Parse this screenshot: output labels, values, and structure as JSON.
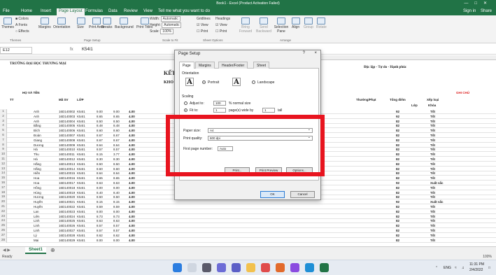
{
  "window": {
    "title": "Book1 - Excel (Product Activation Failed)"
  },
  "tabs": [
    "File",
    "Home",
    "Insert",
    "Page Layout",
    "Formulas",
    "Data",
    "Review",
    "View"
  ],
  "tabs_active": "Page Layout",
  "tell_me": "Tell me what you want to do",
  "account": {
    "signin": "Sign in",
    "share": "Share"
  },
  "ribbon": {
    "themes": "Themes",
    "colors": "Colors",
    "fonts": "Fonts",
    "effects": "Effects",
    "margins": "Margins",
    "orientation": "Orientation",
    "size": "Size",
    "print_area": "Print Area",
    "breaks": "Breaks",
    "background": "Background",
    "print_titles": "Print Titles",
    "width_label": "Width:",
    "width_value": "Automatic",
    "height_label": "Height:",
    "height_value": "Automatic",
    "scale_label": "Scale:",
    "scale_value": "100%",
    "gridlines": "Gridlines",
    "headings": "Headings",
    "view1": "View",
    "view2": "View",
    "print1": "Print",
    "print2": "Print",
    "bring_forward": "Bring Forward",
    "send_backward": "Send Backward",
    "selection_pane": "Selection Pane",
    "align": "Align",
    "group": "Group",
    "rotate": "Rotate",
    "grp_themes": "Themes",
    "grp_page_setup": "Page Setup",
    "grp_scale": "Scale to Fit",
    "grp_sheet_options": "Sheet Options",
    "grp_arrange": "Arrange"
  },
  "formula_bar": {
    "name_box": "E12",
    "fx": "fx",
    "value": "K54I1"
  },
  "sheet": {
    "header_left": "TRƯỜNG ĐẠI HỌC THƯƠNG MẠI",
    "header_mid": "KẾT",
    "header_mid2": "KHO",
    "header_right": "Độc lập - Tự do - Hạnh phúc",
    "gchu": "GHI CHÚ",
    "col_name": "HỌ VÀ TÊN",
    "col_msv": "Mã SV",
    "col_lop": "LỚP",
    "col_tong": "Tổng điểm",
    "col_xeploai": "Xếp loại",
    "col_lop2": "Lớp",
    "col_khoa": "Khóa",
    "col_tt": "TT",
    "col_thuong": "Thưởng/Phạt",
    "rows": [
      {
        "n": "1",
        "name": "Anh",
        "msv": "16D140002",
        "lop": "K54I1",
        "a": "9.00",
        "b": "9.00",
        "c": "4.00",
        "xl": "Tốt",
        "score": "92"
      },
      {
        "n": "2",
        "name": "Anh",
        "msv": "16D140003",
        "lop": "K54I1",
        "a": "8.65",
        "b": "8.65",
        "c": "4.00",
        "xl": "Tốt",
        "score": "92"
      },
      {
        "n": "3",
        "name": "Anh",
        "msv": "16D140004",
        "lop": "K54I1",
        "a": "8.50",
        "b": "8.50",
        "c": "4.00",
        "xl": "Tốt",
        "score": "82"
      },
      {
        "n": "4",
        "name": "Bằng",
        "msv": "16D140005",
        "lop": "K54I1",
        "a": "8.48",
        "b": "8.48",
        "c": "4.00",
        "xl": "Tốt",
        "score": "82"
      },
      {
        "n": "5",
        "name": "Bích",
        "msv": "16D140006",
        "lop": "K54I1",
        "a": "8.60",
        "b": "8.60",
        "c": "4.00",
        "xl": "Tốt",
        "score": "82"
      },
      {
        "n": "6",
        "name": "Đoàn",
        "msv": "16D140007",
        "lop": "K54I1",
        "a": "8.67",
        "b": "8.67",
        "c": "4.00",
        "xl": "Tốt",
        "score": "82"
      },
      {
        "n": "7",
        "name": "Giang",
        "msv": "16D140008",
        "lop": "K54I1",
        "a": "8.67",
        "b": "8.67",
        "c": "4.00",
        "xl": "Tốt",
        "score": "82"
      },
      {
        "n": "8",
        "name": "Dương",
        "msv": "16D140009",
        "lop": "K54I1",
        "a": "8.64",
        "b": "8.64",
        "c": "4.00",
        "xl": "Tốt",
        "score": "82"
      },
      {
        "n": "9",
        "name": "Hà",
        "msv": "16D140010",
        "lop": "K54I1",
        "a": "8.57",
        "b": "8.57",
        "c": "4.00",
        "xl": "Tốt",
        "score": "82"
      },
      {
        "n": "10",
        "name": "Thu",
        "msv": "16D140011",
        "lop": "K54I1",
        "a": "8.15",
        "b": "3.77",
        "c": "4.00",
        "xl": "Tốt",
        "score": "82"
      },
      {
        "n": "11",
        "name": "Hà",
        "msv": "16D140012",
        "lop": "K54I1",
        "a": "8.30",
        "b": "8.30",
        "c": "4.00",
        "xl": "Tốt",
        "score": "82"
      },
      {
        "n": "12",
        "name": "Hằng",
        "msv": "16D140013",
        "lop": "K54I1",
        "a": "8.50",
        "b": "8.50",
        "c": "4.00",
        "xl": "Tốt",
        "score": "82"
      },
      {
        "n": "13",
        "name": "Hằng",
        "msv": "16D140014",
        "lop": "K54I1",
        "a": "8.60",
        "b": "8.60",
        "c": "4.00",
        "xl": "Tốt",
        "score": "82"
      },
      {
        "n": "14",
        "name": "Hiền",
        "msv": "16D140015",
        "lop": "K54I1",
        "a": "8.64",
        "b": "8.64",
        "c": "4.00",
        "xl": "Tốt",
        "score": "82"
      },
      {
        "n": "15",
        "name": "Hoa",
        "msv": "16D140016",
        "lop": "K54I1",
        "a": "8.65",
        "b": "8.65",
        "c": "4.00",
        "xl": "Tốt",
        "score": "82"
      },
      {
        "n": "16",
        "name": "Hoa",
        "msv": "16D140017",
        "lop": "K54I1",
        "a": "8.63",
        "b": "8.63",
        "c": "4.00",
        "xl": "Xuất sắc",
        "score": "92"
      },
      {
        "n": "17",
        "name": "Hồng",
        "msv": "16D140018",
        "lop": "K54I1",
        "a": "8.00",
        "b": "8.00",
        "c": "4.00",
        "xl": "Tốt",
        "score": "82"
      },
      {
        "n": "18",
        "name": "Hùng",
        "msv": "16D140019",
        "lop": "K54I1",
        "a": "8.40",
        "b": "8.40",
        "c": "4.00",
        "xl": "Tốt",
        "score": "82"
      },
      {
        "n": "19",
        "name": "Hương",
        "msv": "16D140020",
        "lop": "K54I1",
        "a": "8.50",
        "b": "8.50",
        "c": "4.00",
        "xl": "Tốt",
        "score": "82"
      },
      {
        "n": "20",
        "name": "Huyền",
        "msv": "16D140021",
        "lop": "K54I1",
        "a": "8.15",
        "b": "8.15",
        "c": "4.00",
        "xl": "Xuất sắc",
        "score": "92"
      },
      {
        "n": "21",
        "name": "Huyền",
        "msv": "16D140022",
        "lop": "K54I1",
        "a": "8.59",
        "b": "8.59",
        "c": "4.00",
        "xl": "Tốt",
        "score": "82"
      },
      {
        "n": "22",
        "name": "Lan",
        "msv": "16D140023",
        "lop": "K54I1",
        "a": "8.00",
        "b": "8.00",
        "c": "4.00",
        "xl": "Tốt",
        "score": "82"
      },
      {
        "n": "23",
        "name": "Liên",
        "msv": "16D140024",
        "lop": "K54I1",
        "a": "8.73",
        "b": "8.73",
        "c": "4.00",
        "xl": "Tốt",
        "score": "82"
      },
      {
        "n": "24",
        "name": "Linh",
        "msv": "16D140025",
        "lop": "K54I1",
        "a": "8.63",
        "b": "8.63",
        "c": "4.00",
        "xl": "Tốt",
        "score": "82"
      },
      {
        "n": "25",
        "name": "Linh",
        "msv": "16D140026",
        "lop": "K54I1",
        "a": "8.57",
        "b": "8.57",
        "c": "4.00",
        "xl": "Tốt",
        "score": "82"
      },
      {
        "n": "26",
        "name": "Linh",
        "msv": "16D140027",
        "lop": "K54I1",
        "a": "8.57",
        "b": "8.57",
        "c": "4.00",
        "xl": "Tốt",
        "score": "82"
      },
      {
        "n": "27",
        "name": "Lý",
        "msv": "16D140028",
        "lop": "K54I1",
        "a": "8.62",
        "b": "8.62",
        "c": "4.00",
        "xl": "Tốt",
        "score": "82"
      },
      {
        "n": "28",
        "name": "Mai",
        "msv": "16D140029",
        "lop": "K54I1",
        "a": "8.00",
        "b": "8.00",
        "c": "4.00",
        "xl": "Tốt",
        "score": "82"
      }
    ]
  },
  "sheet_tab": "Sheet1",
  "status": {
    "left": "Ready",
    "zoom": "100%"
  },
  "taskbar": {
    "time": "11:31 PM",
    "date": "2/4/2022",
    "lang": "ENG"
  },
  "dialog": {
    "title": "Page Setup",
    "help": "?",
    "close": "×",
    "tabs": [
      "Page",
      "Margins",
      "Header/Footer",
      "Sheet"
    ],
    "orientation_label": "Orientation",
    "portrait": "Portrait",
    "landscape": "Landscape",
    "scaling_label": "Scaling",
    "adjust_to": "Adjust to:",
    "adjust_value": "100",
    "normal_size": "% normal size",
    "fit_to": "Fit to:",
    "fit_wide_value": "1",
    "pages_wide_by": "page(s) wide by",
    "fit_tall_value": "1",
    "tall": "tall",
    "paper_size_label": "Paper size:",
    "paper_size_value": "A4",
    "print_quality_label": "Print quality:",
    "print_quality_value": "600 dpi",
    "first_page_label": "First page number:",
    "first_page_value": "Auto",
    "print_btn": "Print...",
    "preview_btn": "Print Preview",
    "options_btn": "Options...",
    "ok": "OK",
    "cancel": "Cancel"
  },
  "colors": {
    "excel_green": "#217346",
    "highlight_red": "#e8141f"
  }
}
